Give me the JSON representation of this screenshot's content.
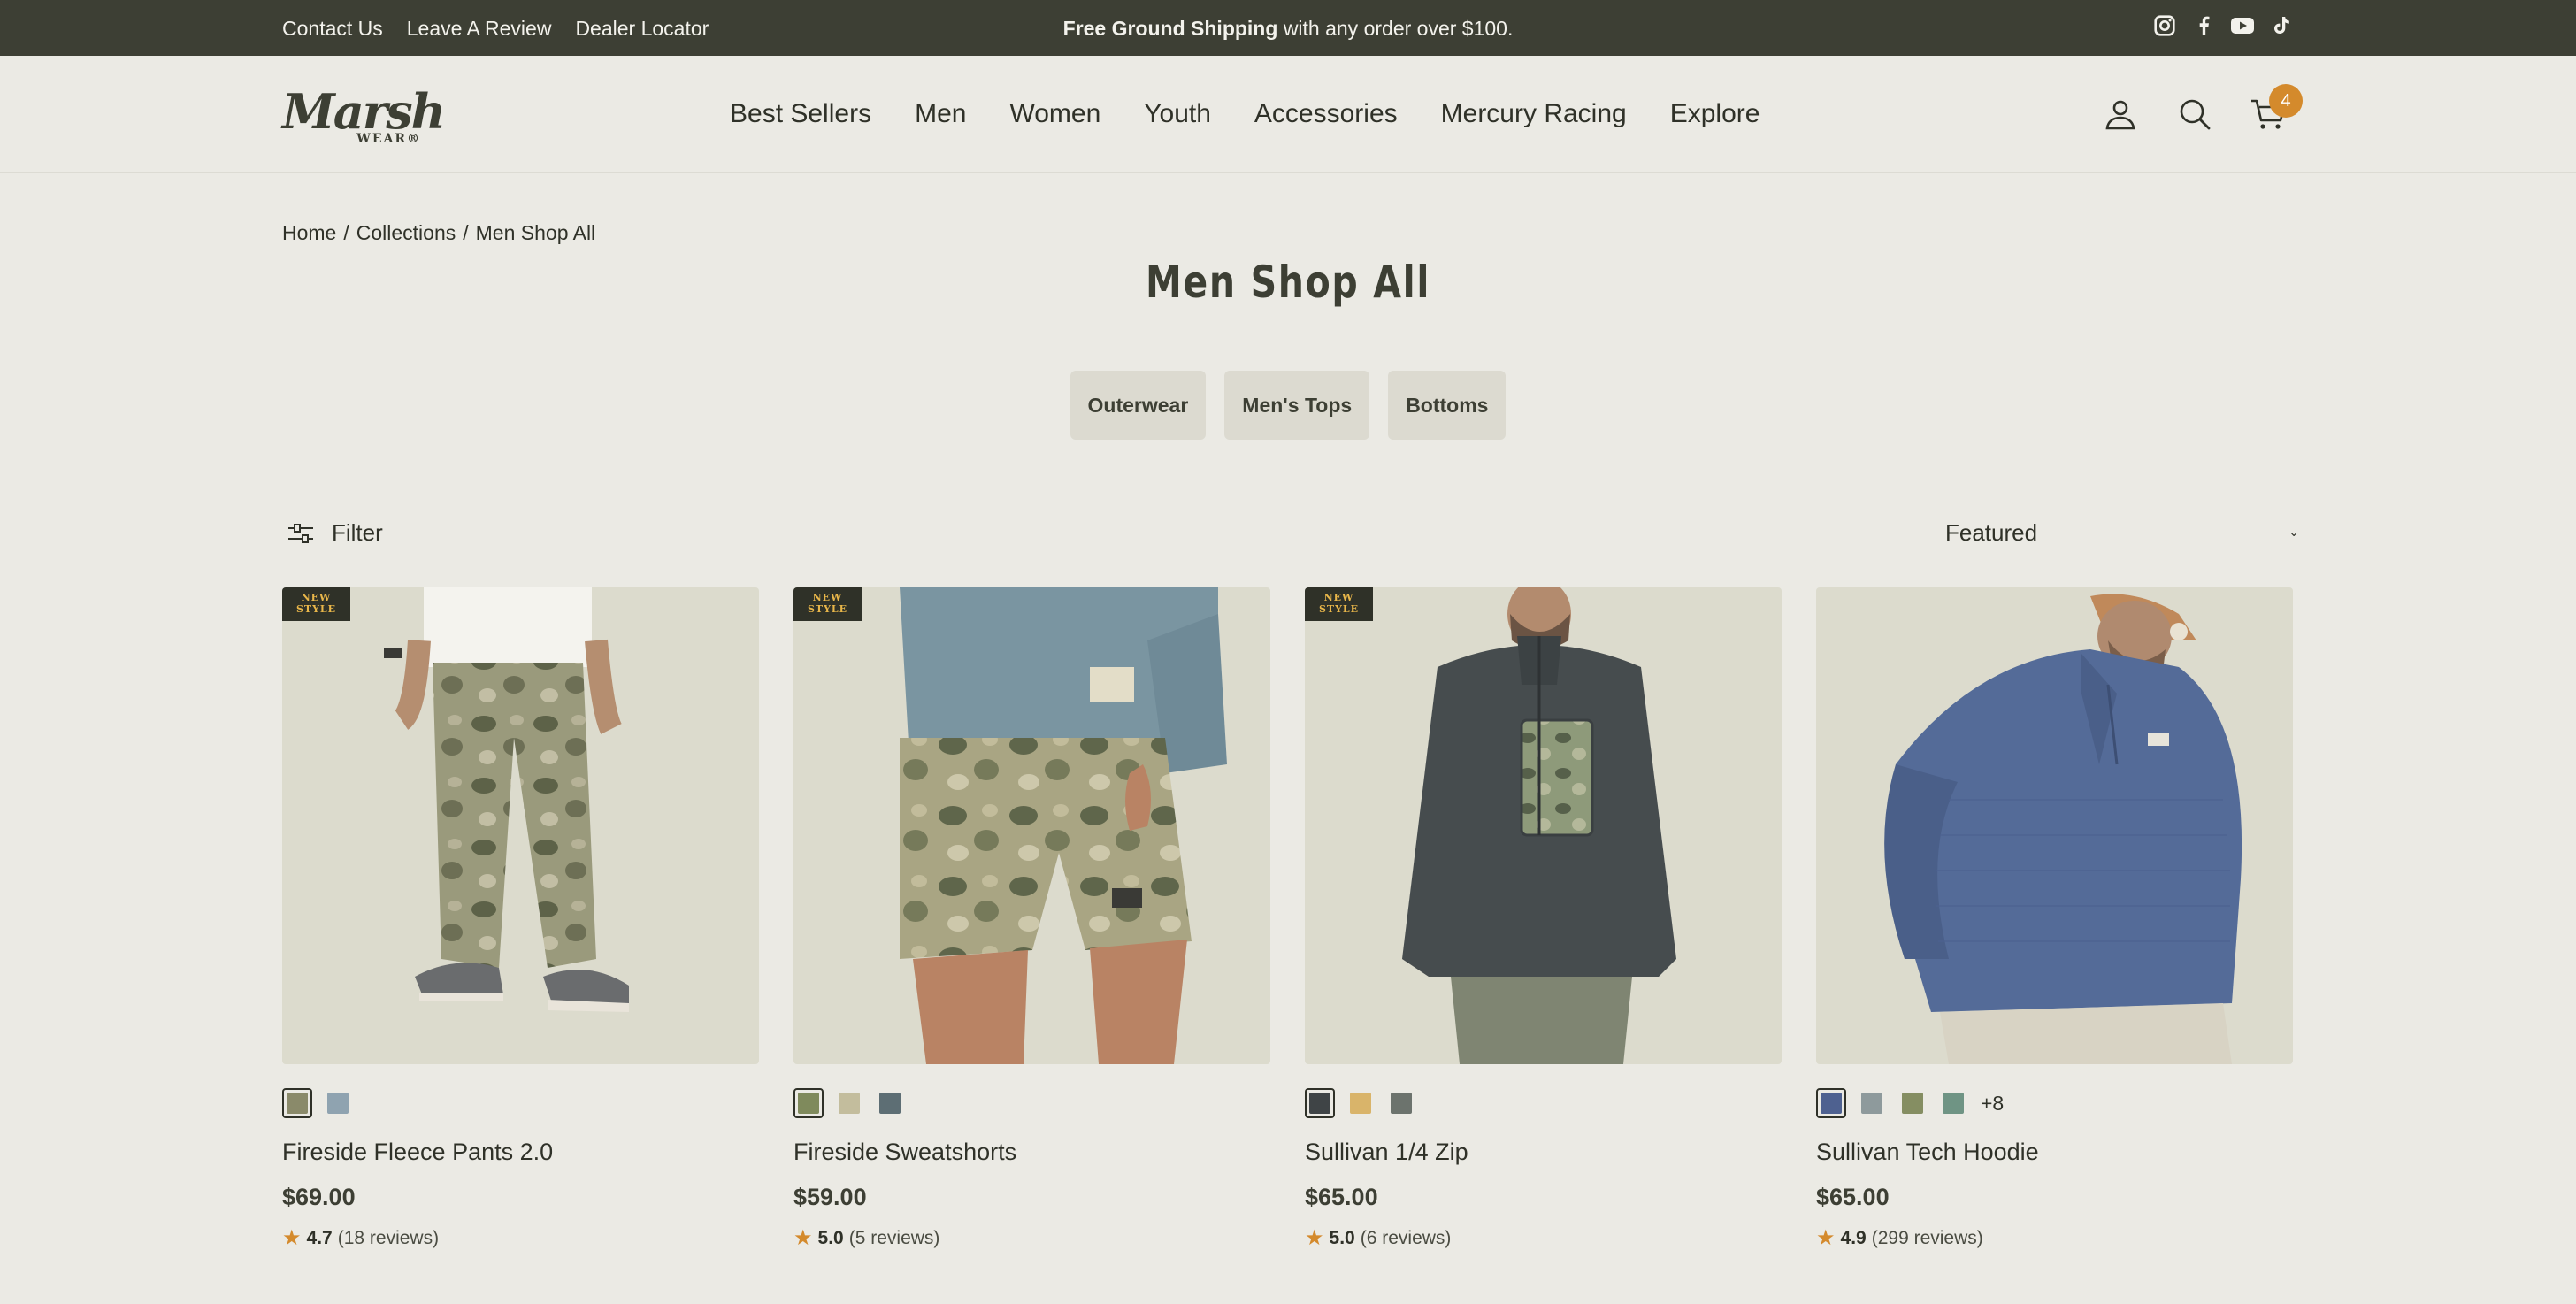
{
  "topbar": {
    "links": [
      "Contact Us",
      "Leave A Review",
      "Dealer Locator"
    ],
    "promo_bold": "Free Ground Shipping",
    "promo_rest": "with any order over $100.",
    "social": [
      "instagram-icon",
      "facebook-icon",
      "youtube-icon",
      "tiktok-icon"
    ]
  },
  "header": {
    "logo_script": "Marsh",
    "logo_sub": "WEAR®",
    "nav": [
      "Best Sellers",
      "Men",
      "Women",
      "Youth",
      "Accessories",
      "Mercury Racing",
      "Explore"
    ],
    "cart_count": "4"
  },
  "breadcrumb": {
    "home": "Home",
    "sep": "/",
    "collections": "Collections",
    "current": "Men Shop All"
  },
  "page_title": "Men Shop All",
  "categories": [
    "Outerwear",
    "Men's Tops",
    "Bottoms"
  ],
  "filter_label": "Filter",
  "sort_label": "Featured",
  "badge": {
    "line1": "NEW",
    "line2": "STYLE"
  },
  "products": [
    {
      "name": "Fireside Fleece Pants 2.0",
      "price": "$69.00",
      "rating": "4.7",
      "reviews": "(18 reviews)",
      "new_style": true,
      "swatches": [
        "#8a8a6a",
        "#8fa3b0"
      ],
      "more": ""
    },
    {
      "name": "Fireside Sweatshorts",
      "price": "$59.00",
      "rating": "5.0",
      "reviews": "(5 reviews)",
      "new_style": true,
      "swatches": [
        "#7f8a5c",
        "#c3bd9d",
        "#5d6e74"
      ],
      "more": ""
    },
    {
      "name": "Sullivan 1/4 Zip",
      "price": "$65.00",
      "rating": "5.0",
      "reviews": "(6 reviews)",
      "new_style": true,
      "swatches": [
        "#3f4446",
        "#d9b46a",
        "#6c736d"
      ],
      "more": ""
    },
    {
      "name": "Sullivan Tech Hoodie",
      "price": "$65.00",
      "rating": "4.9",
      "reviews": "(299 reviews)",
      "new_style": false,
      "swatches": [
        "#4e6190",
        "#8e9a9c",
        "#858e62",
        "#6f9484"
      ],
      "more": "+8"
    }
  ],
  "colors": {
    "accent": "#d48a2c",
    "dark": "#3d3f34",
    "background": "#ebeae4"
  }
}
